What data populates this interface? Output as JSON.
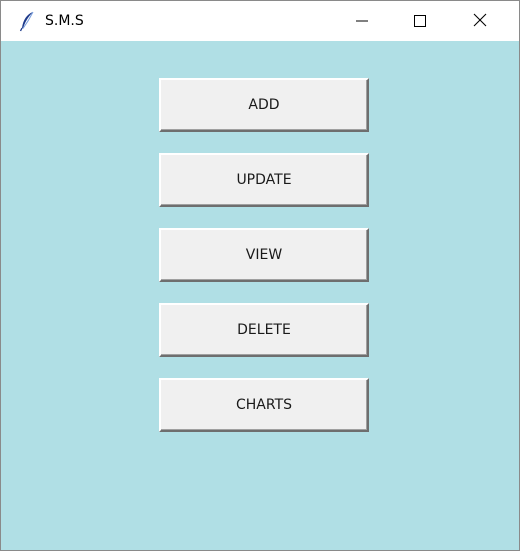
{
  "window": {
    "title": "S.M.S",
    "controls": {
      "minimize_icon": "minimize-icon",
      "maximize_icon": "maximize-icon",
      "close_icon": "close-icon"
    }
  },
  "menu": {
    "buttons": [
      {
        "label": "ADD"
      },
      {
        "label": "UPDATE"
      },
      {
        "label": "VIEW"
      },
      {
        "label": "DELETE"
      },
      {
        "label": "CHARTS"
      }
    ]
  },
  "colors": {
    "background": "#b0dfe5",
    "button_face": "#f0f0f0"
  }
}
